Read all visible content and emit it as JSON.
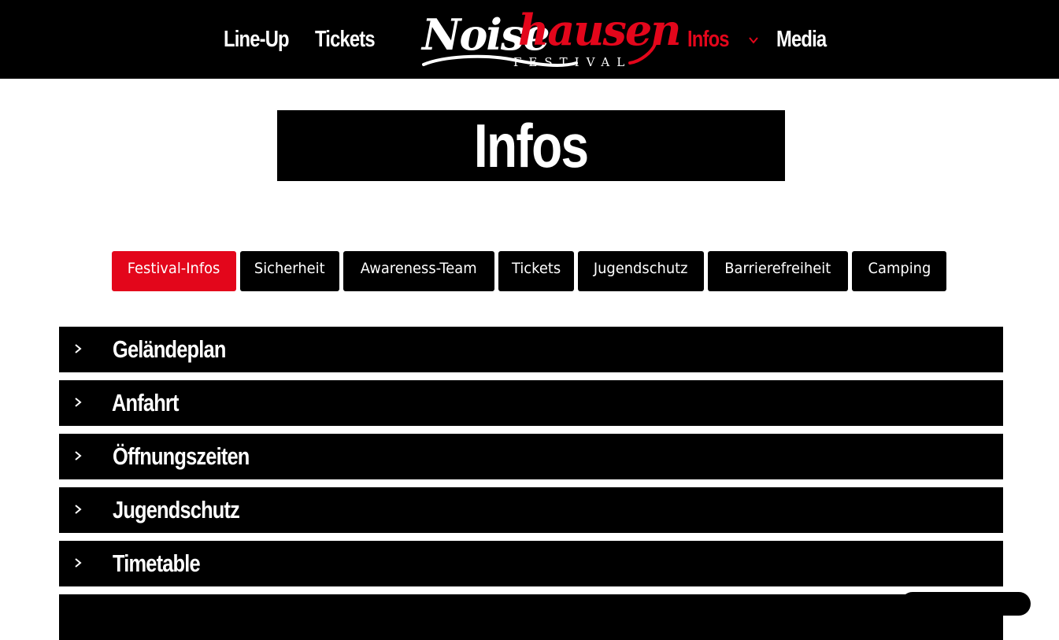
{
  "nav": {
    "left": [
      "Line-Up",
      "Tickets"
    ],
    "right": [
      "Infos",
      "Media"
    ],
    "active": "Infos",
    "chevron_icon": "chevron-down-icon"
  },
  "logo": {
    "part1": "Noise",
    "part2": "hausen",
    "sub": "FESTIVAL"
  },
  "page": {
    "title": "Infos"
  },
  "tabs": [
    {
      "label": "Festival-Infos",
      "active": true
    },
    {
      "label": "Sicherheit",
      "active": false
    },
    {
      "label": "Awareness-Team",
      "active": false
    },
    {
      "label": "Tickets",
      "active": false
    },
    {
      "label": "Jugendschutz",
      "active": false
    },
    {
      "label": "Barrierefreiheit",
      "active": false
    },
    {
      "label": "Camping",
      "active": false
    }
  ],
  "accordion": [
    {
      "title": "Geländeplan"
    },
    {
      "title": "Anfahrt"
    },
    {
      "title": "Öffnungszeiten"
    },
    {
      "title": "Jugendschutz"
    },
    {
      "title": "Timetable"
    }
  ],
  "colors": {
    "accent": "#e3061b",
    "dark": "#000000",
    "light": "#ffffff"
  }
}
